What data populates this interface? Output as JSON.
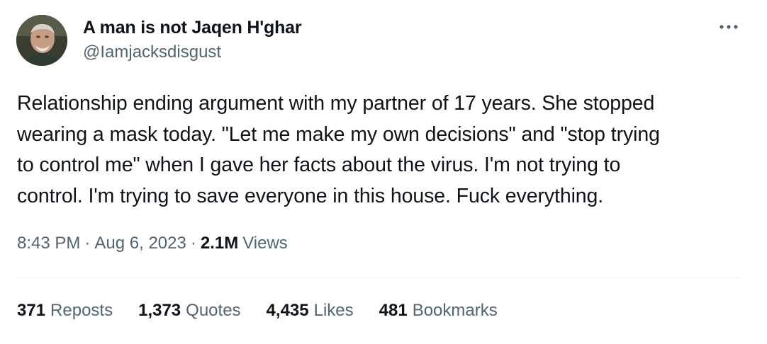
{
  "author": {
    "display_name": "A man is not Jaqen H'ghar",
    "handle": "@Iamjacksdisgust"
  },
  "tweet": {
    "lines": [
      "Relationship ending argument with my partner of 17 years. She stopped",
      "wearing a mask today. \"Let me make my own decisions\" and \"stop trying",
      "to control me\" when I gave her facts about the virus. I'm not trying to",
      "control. I'm trying to save everyone in this house. Fuck everything."
    ],
    "time": "8:43 PM",
    "date": "Aug 6, 2023",
    "separator": "·",
    "views_count": "2.1M",
    "views_label": "Views"
  },
  "stats": [
    {
      "count": "371",
      "label": "Reposts"
    },
    {
      "count": "1,373",
      "label": "Quotes"
    },
    {
      "count": "4,435",
      "label": "Likes"
    },
    {
      "count": "481",
      "label": "Bookmarks"
    }
  ],
  "icons": {
    "more": "more-horizontal-icon",
    "avatar": "profile-photo"
  },
  "colors": {
    "primary_text": "#0f1419",
    "secondary_text": "#536471",
    "divider": "#eff3f4",
    "background": "#ffffff"
  }
}
